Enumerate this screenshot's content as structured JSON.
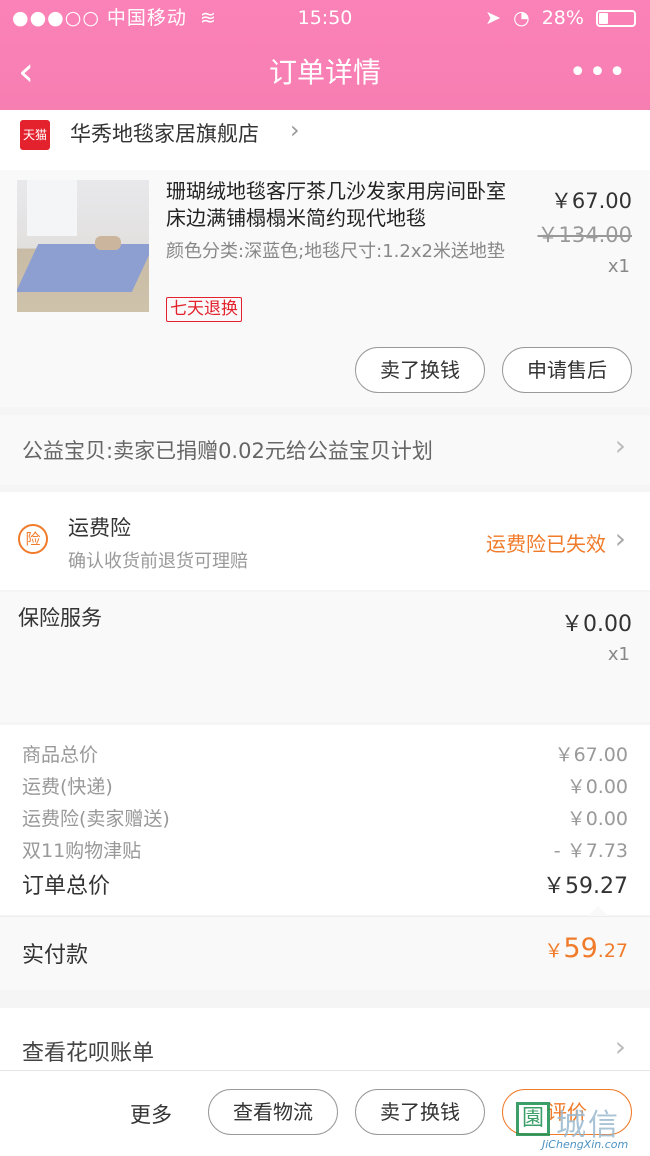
{
  "status_bar": {
    "carrier": "●●●○○ 中国移动",
    "wifi_icon": "wifi-icon",
    "time": "15:50",
    "right": "28%",
    "icons": [
      "location-arrow-icon",
      "alarm-icon",
      "battery-icon"
    ]
  },
  "nav": {
    "back_glyph": "‹",
    "title": "订单详情",
    "more_glyph": "•••"
  },
  "shop": {
    "badge": "天猫",
    "name": "华秀地毯家居旗舰店",
    "chevron": "›"
  },
  "item": {
    "title": "珊瑚绒地毯客厅茶几沙发家用房间卧室床边满铺榻榻米简约现代地毯",
    "spec": "颜色分类:深蓝色;地毯尺寸:1.2x2米送地垫",
    "tag": "七天退换",
    "price": "￥67.00",
    "original_price": "￥134.00",
    "quantity": "x1",
    "buttons": {
      "sell": "卖了换钱",
      "after_sale": "申请售后"
    }
  },
  "charity": {
    "text": "公益宝贝:卖家已捐赠0.02元给公益宝贝计划",
    "chevron": "›"
  },
  "insurance": {
    "icon_char": "险",
    "title": "运费险",
    "subtitle": "确认收货前退货可理赔",
    "status": "运费险已失效",
    "chevron": "›"
  },
  "service": {
    "title": "保险服务",
    "price": "￥0.00",
    "quantity": "x1"
  },
  "totals": {
    "rows": [
      {
        "label": "商品总价",
        "value": "￥67.00"
      },
      {
        "label": "运费(快递)",
        "value": "￥0.00"
      },
      {
        "label": "运费险(卖家赠送)",
        "value": "￥0.00"
      },
      {
        "label": "双11购物津贴",
        "value": "- ￥7.73"
      }
    ],
    "order_total_label": "订单总价",
    "order_total_value": "￥59.27",
    "paid_label": "实付款",
    "paid_currency": "￥",
    "paid_int": "59",
    "paid_dec": ".27"
  },
  "huabei": {
    "text": "查看花呗账单",
    "chevron": "›"
  },
  "bottom_bar": {
    "more": "更多",
    "logistics": "查看物流",
    "sell": "卖了换钱",
    "review": "评价"
  },
  "watermark": {
    "logo": "園",
    "text": "城信",
    "url": "JiChengXin.com"
  },
  "colors": {
    "header": "#f77eb1",
    "accent_orange": "#f07b2a",
    "tmall_red": "#e3222d"
  }
}
